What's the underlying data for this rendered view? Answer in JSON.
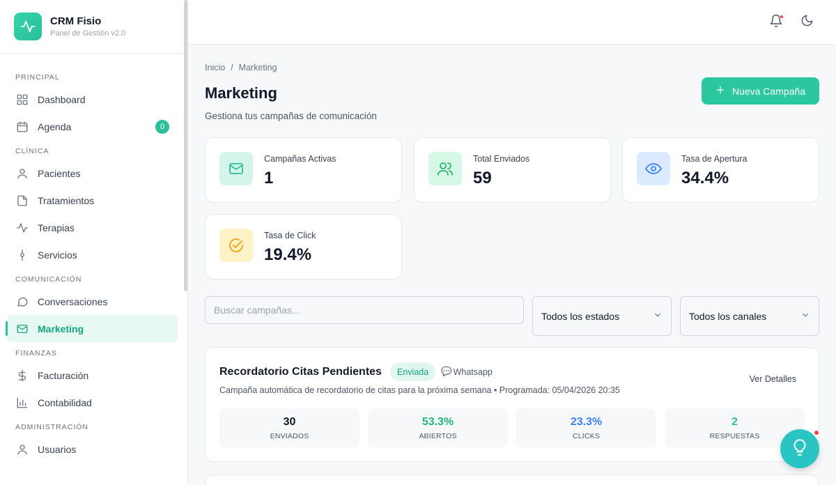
{
  "brand": {
    "name": "CRM Fisio",
    "subtitle": "Panel de Gestión v2.0"
  },
  "sidebar": {
    "sections": [
      {
        "title": "PRINCIPAL",
        "items": [
          {
            "label": "Dashboard",
            "icon": "grid-icon"
          },
          {
            "label": "Agenda",
            "icon": "calendar-icon",
            "badge": "0"
          }
        ]
      },
      {
        "title": "CLÍNICA",
        "items": [
          {
            "label": "Pacientes",
            "icon": "user-icon"
          },
          {
            "label": "Tratamientos",
            "icon": "file-icon"
          },
          {
            "label": "Terapias",
            "icon": "activity-icon"
          },
          {
            "label": "Servicios",
            "icon": "service-icon"
          }
        ]
      },
      {
        "title": "COMUNICACIÓN",
        "items": [
          {
            "label": "Conversaciones",
            "icon": "message-icon"
          },
          {
            "label": "Marketing",
            "icon": "mail-icon",
            "active": true
          }
        ]
      },
      {
        "title": "FINANZAS",
        "items": [
          {
            "label": "Facturación",
            "icon": "dollar-icon"
          },
          {
            "label": "Contabilidad",
            "icon": "bar-chart-icon"
          }
        ]
      },
      {
        "title": "ADMINISTRACIÓN",
        "items": [
          {
            "label": "Usuarios",
            "icon": "user-icon"
          }
        ]
      }
    ]
  },
  "breadcrumb": {
    "home": "Inicio",
    "separator": "/",
    "current": "Marketing"
  },
  "page": {
    "title": "Marketing",
    "subtitle": "Gestiona tus campañas de comunicación",
    "new_button": "Nueva Campaña"
  },
  "stats": [
    {
      "label": "Campañas Activas",
      "value": "1",
      "icon": "mail-icon",
      "bg": "#d5f5eb",
      "fg": "#2bbf9a"
    },
    {
      "label": "Total Enviados",
      "value": "59",
      "icon": "users-icon",
      "bg": "#d8f8e6",
      "fg": "#22b573"
    },
    {
      "label": "Tasa de Apertura",
      "value": "34.4%",
      "icon": "eye-icon",
      "bg": "#dbeafe",
      "fg": "#3b82f6"
    },
    {
      "label": "Tasa de Click",
      "value": "19.4%",
      "icon": "check-circle-icon",
      "bg": "#fef3c7",
      "fg": "#f59e0b"
    }
  ],
  "filters": {
    "search_placeholder": "Buscar campañas...",
    "status_select": "Todos los estados",
    "channel_select": "Todos los canales"
  },
  "campaign": {
    "title": "Recordatorio Citas Pendientes",
    "status": "Enviada",
    "channel_emoji": "💬",
    "channel": "Whatsapp",
    "description": "Campaña automática de recordatorio de citas para la próxima semana • Programada: 05/04/2026 20:35",
    "details_link": "Ver Detalles",
    "metrics": [
      {
        "value": "30",
        "label": "ENVIADOS",
        "color": "#111827"
      },
      {
        "value": "53.3%",
        "label": "ABIERTOS",
        "color": "#22b573"
      },
      {
        "value": "23.3%",
        "label": "CLICKS",
        "color": "#3b82f6"
      },
      {
        "value": "2",
        "label": "RESPUESTAS",
        "color": "#2bbf9a"
      }
    ]
  }
}
